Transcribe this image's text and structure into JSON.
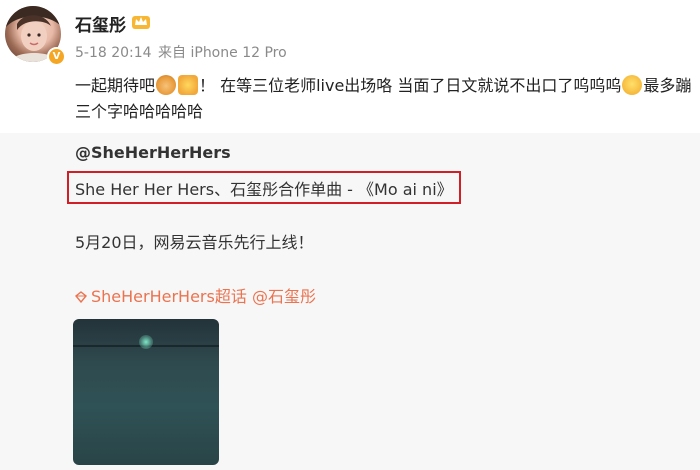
{
  "post": {
    "username": "石玺彤",
    "date": "5-18 20:14",
    "source": "来自 iPhone 12 Pro",
    "text_part1": "一起期待吧",
    "text_part2": "！ 在等三位老师live出场咯 当面了日文就说不出口了呜呜呜",
    "text_part3": "最多蹦三个字哈哈哈哈哈"
  },
  "repost": {
    "author": "@SheHerHerHers",
    "song_line": "She Her Her Hers、石玺彤合作单曲 - 《Mo ai ni》",
    "release_line": "5月20日，网易云音乐先行上线！",
    "topic": "SheHerHerHers超话",
    "mention": "@石玺彤"
  },
  "colors": {
    "accent_link": "#eb7350",
    "highlight_box": "#d11f27",
    "repost_bg": "#f7f7f7"
  }
}
